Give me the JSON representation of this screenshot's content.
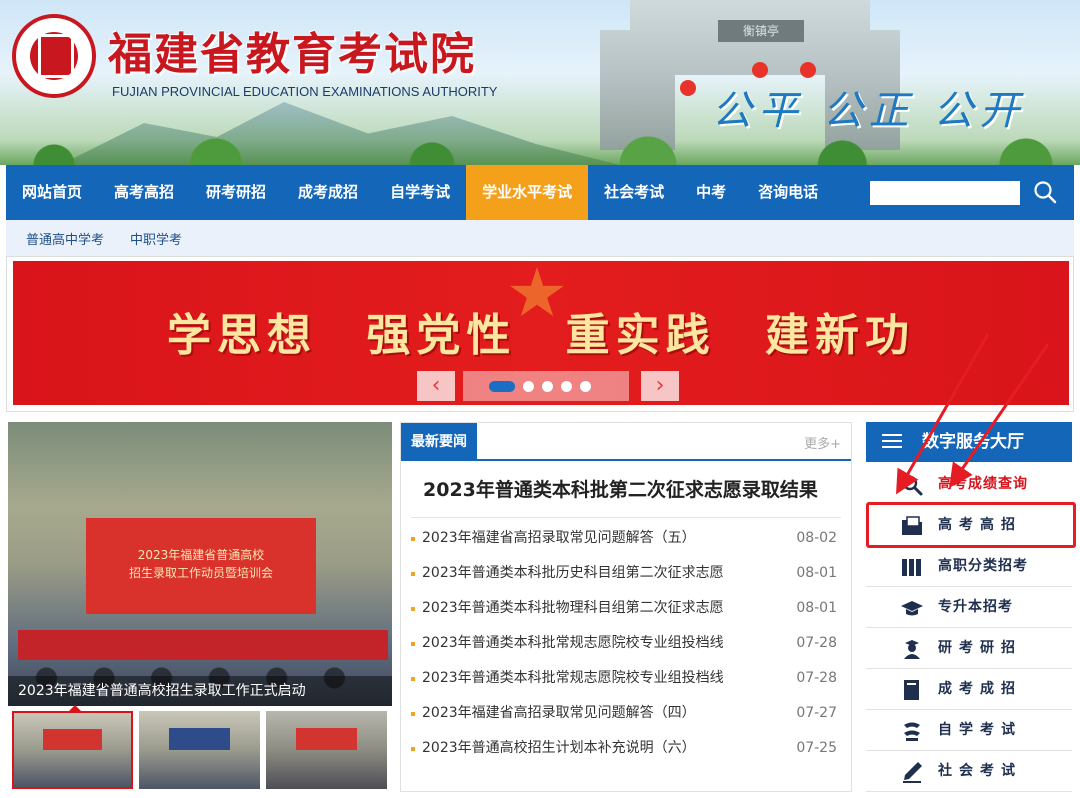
{
  "header": {
    "title": "福建省教育考试院",
    "subtitle": "FUJIAN PROVINCIAL EDUCATION EXAMINATIONS AUTHORITY",
    "slogan": "公平 公正 公开",
    "gate_sign": "衡镇亭"
  },
  "nav": {
    "items": [
      {
        "label": "网站首页"
      },
      {
        "label": "高考高招"
      },
      {
        "label": "研考研招"
      },
      {
        "label": "成考成招"
      },
      {
        "label": "自学考试"
      },
      {
        "label": "学业水平考试",
        "active": true
      },
      {
        "label": "社会考试"
      },
      {
        "label": "中考"
      },
      {
        "label": "咨询电话"
      }
    ],
    "search_placeholder": ""
  },
  "subnav": {
    "items": [
      {
        "label": "普通高中学考"
      },
      {
        "label": "中职学考"
      }
    ]
  },
  "banner": {
    "text": "学思想 强党性 重实践 建新功",
    "prev_glyph": "‹",
    "next_glyph": "›",
    "slide_count": 5,
    "active_slide": 1
  },
  "photo_news": {
    "screen_text_line1": "2023年福建省普通高校",
    "screen_text_line2": "招生录取工作动员暨培训会",
    "caption": "2023年福建省普通高校招生录取工作正式启动",
    "thumb_count": 3,
    "active_thumb": 1
  },
  "news": {
    "tab_label": "最新要闻",
    "more_label": "更多+",
    "headline": "2023年普通类本科批第二次征求志愿录取结果",
    "items": [
      {
        "title": "2023年福建省高招录取常见问题解答（五）",
        "date": "08-02"
      },
      {
        "title": "2023年普通类本科批历史科目组第二次征求志愿",
        "date": "08-01"
      },
      {
        "title": "2023年普通类本科批物理科目组第二次征求志愿",
        "date": "08-01"
      },
      {
        "title": "2023年普通类本科批常规志愿院校专业组投档线",
        "date": "07-28"
      },
      {
        "title": "2023年普通类本科批常规志愿院校专业组投档线",
        "date": "07-28"
      },
      {
        "title": "2023年福建省高招录取常见问题解答（四）",
        "date": "07-27"
      },
      {
        "title": "2023年普通高校招生计划本补充说明（六）",
        "date": "07-25"
      }
    ]
  },
  "service": {
    "title": "数字服务大厅",
    "items": [
      {
        "label": "高考成绩查询",
        "icon": "search-icon"
      },
      {
        "label": "高考高招",
        "icon": "folder-icon"
      },
      {
        "label": "高职分类招考",
        "icon": "books-icon"
      },
      {
        "label": "专升本招考",
        "icon": "graduation-cap-icon"
      },
      {
        "label": "研考研招",
        "icon": "graduate-icon"
      },
      {
        "label": "成考成招",
        "icon": "book-icon"
      },
      {
        "label": "自学考试",
        "icon": "self-study-icon"
      },
      {
        "label": "社会考试",
        "icon": "pen-icon"
      }
    ]
  },
  "colors": {
    "nav_blue": "#1366b8",
    "nav_active": "#f5a01a",
    "brand_red": "#c8171e",
    "annotation_red": "#e51c23"
  }
}
